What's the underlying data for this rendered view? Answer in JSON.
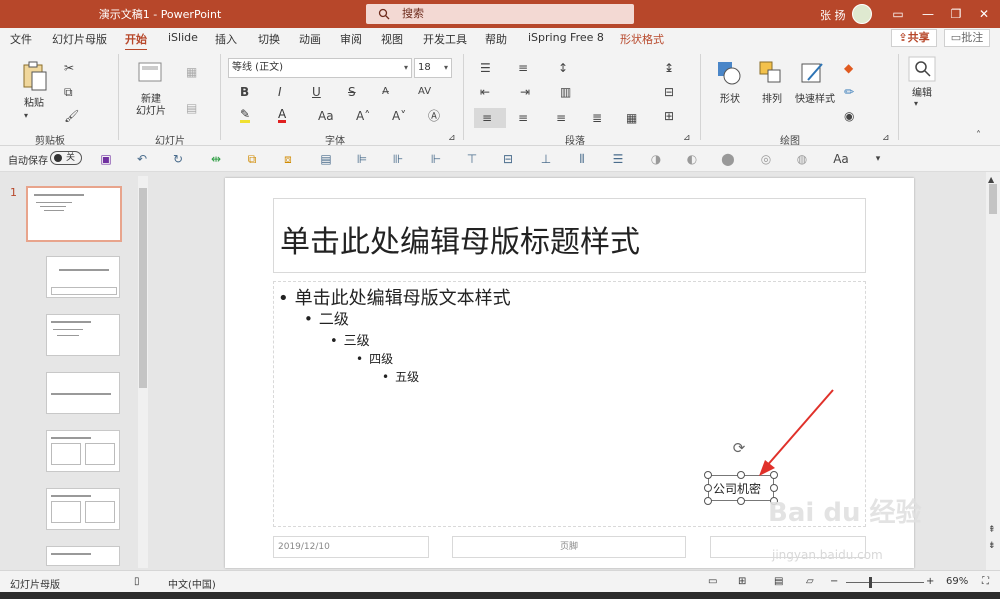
{
  "titlebar": {
    "doc_title": "演示文稿1  -  PowerPoint",
    "search_placeholder": "搜索",
    "user_name": "张 扬"
  },
  "menu": {
    "tabs": [
      {
        "label": "文件"
      },
      {
        "label": "幻灯片母版"
      },
      {
        "label": "开始"
      },
      {
        "label": "iSlide"
      },
      {
        "label": "插入"
      },
      {
        "label": "切换"
      },
      {
        "label": "动画"
      },
      {
        "label": "审阅"
      },
      {
        "label": "视图"
      },
      {
        "label": "开发工具"
      },
      {
        "label": "帮助"
      },
      {
        "label": "iSpring Free 8"
      },
      {
        "label": "形状格式"
      }
    ],
    "active_tab": "开始",
    "share": "共享",
    "comment": "批注"
  },
  "ribbon": {
    "clipboard": {
      "paste": "粘贴",
      "group": "剪贴板"
    },
    "slides": {
      "new_slide": "新建\n幻灯片",
      "group": "幻灯片"
    },
    "font": {
      "name": "等线 (正文)",
      "size": "18",
      "group": "字体"
    },
    "paragraph": {
      "group": "段落"
    },
    "drawing": {
      "shape": "形状",
      "arrange": "排列",
      "quick_styles": "快速样式",
      "group": "绘图"
    },
    "editing": {
      "edit": "编辑"
    }
  },
  "qat": {
    "autosave": "自动保存",
    "toggle": "关",
    "font_case": "Aa"
  },
  "thumbs": {
    "master_number": "1"
  },
  "slide": {
    "title": "单击此处编辑母版标题样式",
    "levels": [
      "单击此处编辑母版文本样式",
      "二级",
      "三级",
      "四级",
      "五级"
    ],
    "footer_date": "2019/12/10",
    "footer_center": "页脚",
    "textbox": "公司机密"
  },
  "status": {
    "view": "幻灯片母版",
    "language": "中文(中国)",
    "zoom": "69%"
  },
  "watermark": {
    "brand": "Bai du 经验",
    "url": "jingyan.baidu.com"
  },
  "colors": {
    "accent": "#b7472a",
    "annotation_arrow": "#e0312a"
  }
}
